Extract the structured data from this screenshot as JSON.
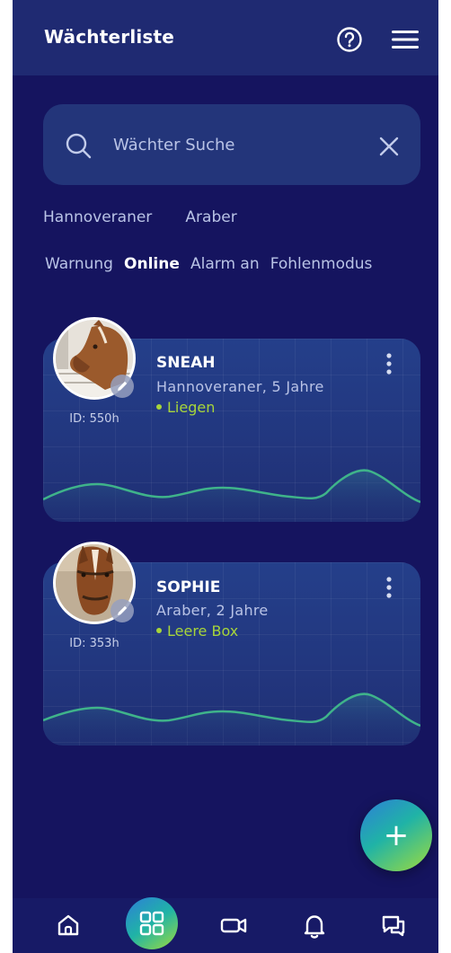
{
  "header": {
    "title": "Wächterliste",
    "help_icon": "help-circle-icon",
    "menu_icon": "hamburger-menu-icon"
  },
  "search": {
    "placeholder": "Wächter Suche",
    "value": ""
  },
  "filters": {
    "breeds": [
      "Hannoveraner",
      "Araber"
    ],
    "statuses": [
      {
        "label": "Warnung",
        "active": false
      },
      {
        "label": "Online",
        "active": true
      },
      {
        "label": "Alarm an",
        "active": false
      },
      {
        "label": "Fohlenmodus",
        "active": false
      }
    ]
  },
  "horses": [
    {
      "name": "SNEAH",
      "meta": "Hannoveraner, 5 Jahre",
      "status": "Liegen",
      "id": "ID: 550h"
    },
    {
      "name": "SOPHIE",
      "meta": "Araber, 2 Jahre",
      "status": "Leere Box",
      "id": "ID: 353h"
    }
  ],
  "fab": {
    "label": "+"
  },
  "bottom_nav": {
    "items": [
      "home-icon",
      "dashboard-grid-icon",
      "video-camera-icon",
      "bell-icon",
      "chat-icon"
    ],
    "active": "dashboard-grid-icon"
  },
  "colors": {
    "background": "#15145f",
    "header": "#1f2a72",
    "card": "#243f8a",
    "status_green": "#a7d53a",
    "accent_gradient_start": "#2d7fd8",
    "accent_gradient_end": "#9fdc3c"
  }
}
